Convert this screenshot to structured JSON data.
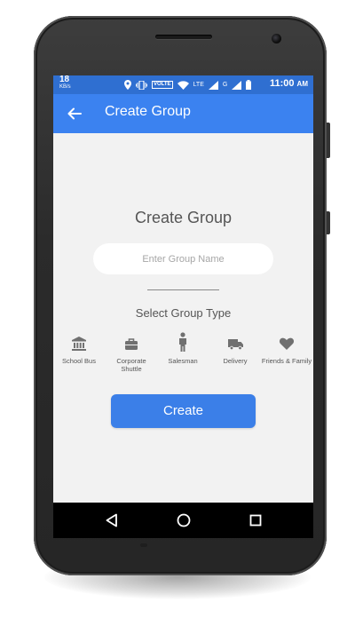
{
  "status_bar": {
    "net_speed_value": "18",
    "net_speed_unit": "KB/s",
    "volte": "VOLTE",
    "lte": "LTE",
    "g": "G",
    "time": "11:00",
    "ampm": "AM"
  },
  "app_bar": {
    "title": "Create Group",
    "color": "#3b82f0"
  },
  "form": {
    "heading": "Create Group",
    "name_input": {
      "placeholder": "Enter Group Name",
      "value": ""
    },
    "type_heading": "Select Group Type",
    "group_types": [
      {
        "label": "School Bus",
        "icon": "bank-icon"
      },
      {
        "label": "Corporate Shuttle",
        "icon": "briefcase-icon"
      },
      {
        "label": "Salesman",
        "icon": "person-icon"
      },
      {
        "label": "Delivery",
        "icon": "truck-icon"
      },
      {
        "label": "Friends & Family",
        "icon": "heart-icon"
      }
    ],
    "create_button": "Create",
    "button_color": "#3b7fe8"
  },
  "nav_bar": {
    "buttons": [
      "back-triangle-icon",
      "home-circle-icon",
      "recents-square-icon"
    ]
  }
}
